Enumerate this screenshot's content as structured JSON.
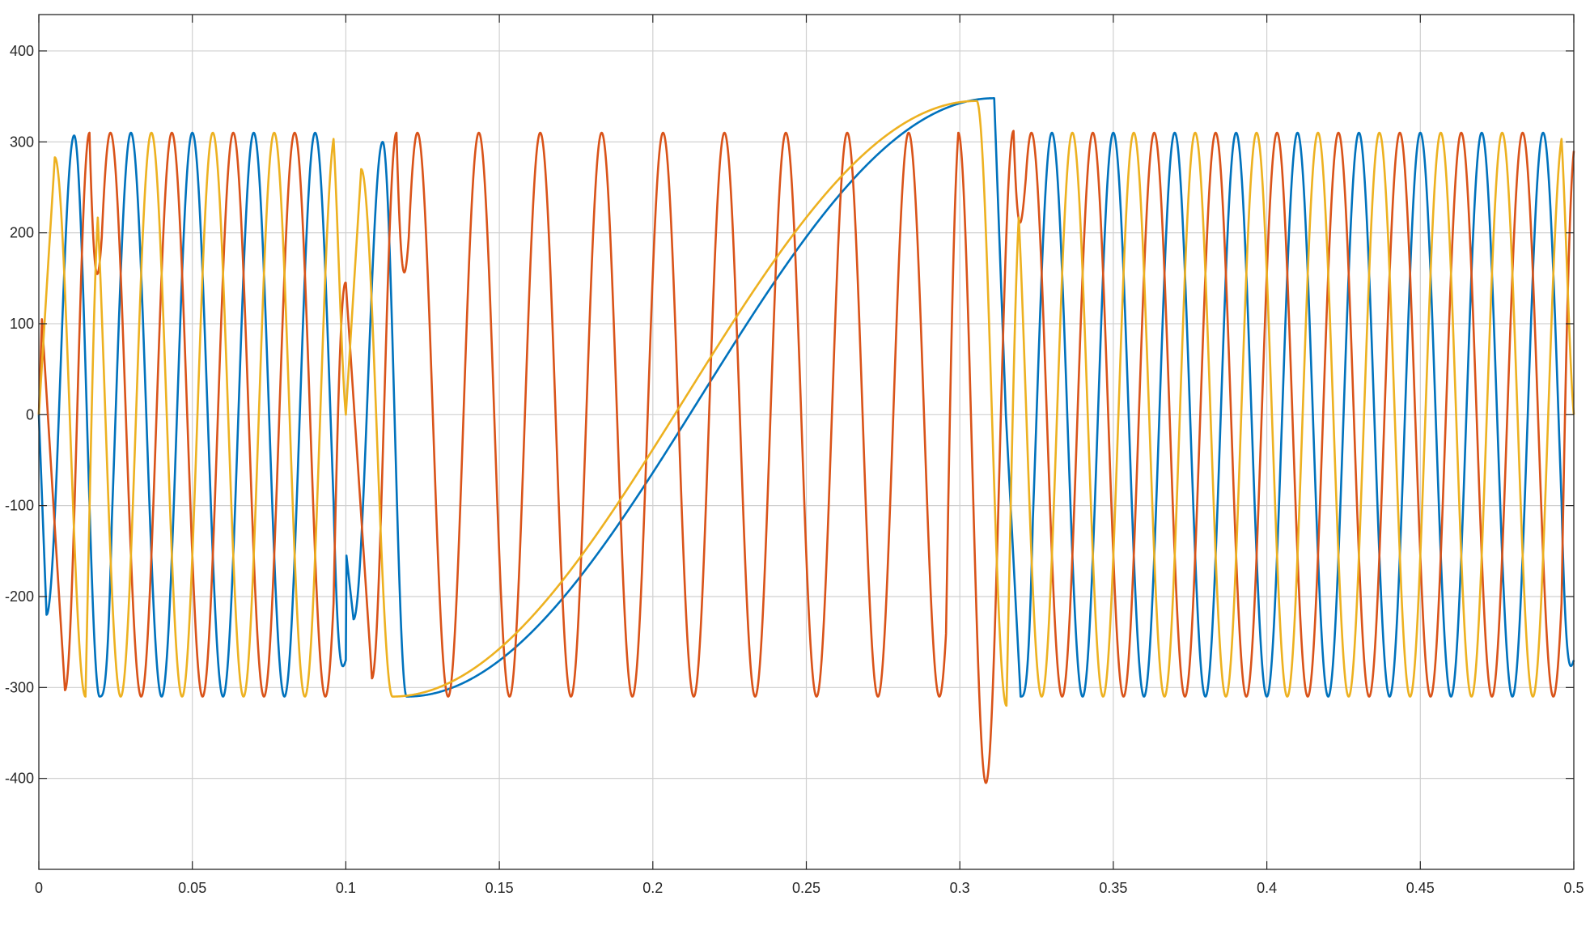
{
  "chart_data": {
    "type": "line",
    "title": "",
    "xlabel": "",
    "ylabel": "",
    "xlim": [
      0,
      0.5
    ],
    "ylim": [
      -500,
      440
    ],
    "xticks": [
      0,
      0.05,
      0.1,
      0.15,
      0.2,
      0.25,
      0.3,
      0.35,
      0.4,
      0.45,
      0.5
    ],
    "xtick_labels": [
      "0",
      "0.05",
      "0.1",
      "0.15",
      "0.2",
      "0.25",
      "0.3",
      "0.35",
      "0.4",
      "0.45",
      "0.5"
    ],
    "yticks": [
      400,
      300,
      200,
      100,
      0,
      -100,
      -200,
      -300,
      -400
    ],
    "ytick_labels": [
      "400",
      "300",
      "200",
      "100",
      "0",
      "-100",
      "-200",
      "-300",
      "-400"
    ],
    "grid": true,
    "legend": "none",
    "frequency_hz": 50,
    "amplitude": 310,
    "series": [
      {
        "color": "#0072BD",
        "phase_deg": -90,
        "points": [
          [
            0,
            0
          ],
          [
            0.0025,
            -220
          ],
          [
            0.0115,
            307
          ],
          [
            0.0198,
            -310
          ],
          [
            0.1,
            -270
          ],
          [
            0.1002,
            -155
          ],
          [
            0.1025,
            -225
          ],
          [
            0.112,
            300
          ],
          [
            0.1198,
            -310
          ],
          [
            0.3112,
            348
          ],
          [
            0.315,
            0
          ],
          [
            0.3198,
            -310
          ],
          [
            0.5,
            -270
          ]
        ]
      },
      {
        "color": "#D95319",
        "phase_deg": 30,
        "points": [
          [
            0,
            0
          ],
          [
            0.001,
            105
          ],
          [
            0.0085,
            -303
          ],
          [
            0.0165,
            310
          ],
          [
            0.1,
            145
          ],
          [
            0.1085,
            -290
          ],
          [
            0.1165,
            310
          ],
          [
            0.2995,
            310
          ],
          [
            0.3085,
            -405
          ],
          [
            0.3175,
            312
          ],
          [
            0.5,
            290
          ]
        ]
      },
      {
        "color": "#EDB120",
        "phase_deg": 150,
        "points": [
          [
            0,
            0
          ],
          [
            0.0052,
            283
          ],
          [
            0.0152,
            -310
          ],
          [
            0.1,
            0
          ],
          [
            0.105,
            270
          ],
          [
            0.1152,
            -310
          ],
          [
            0.3055,
            345
          ],
          [
            0.3152,
            -320
          ],
          [
            0.5,
            0
          ]
        ]
      }
    ]
  }
}
